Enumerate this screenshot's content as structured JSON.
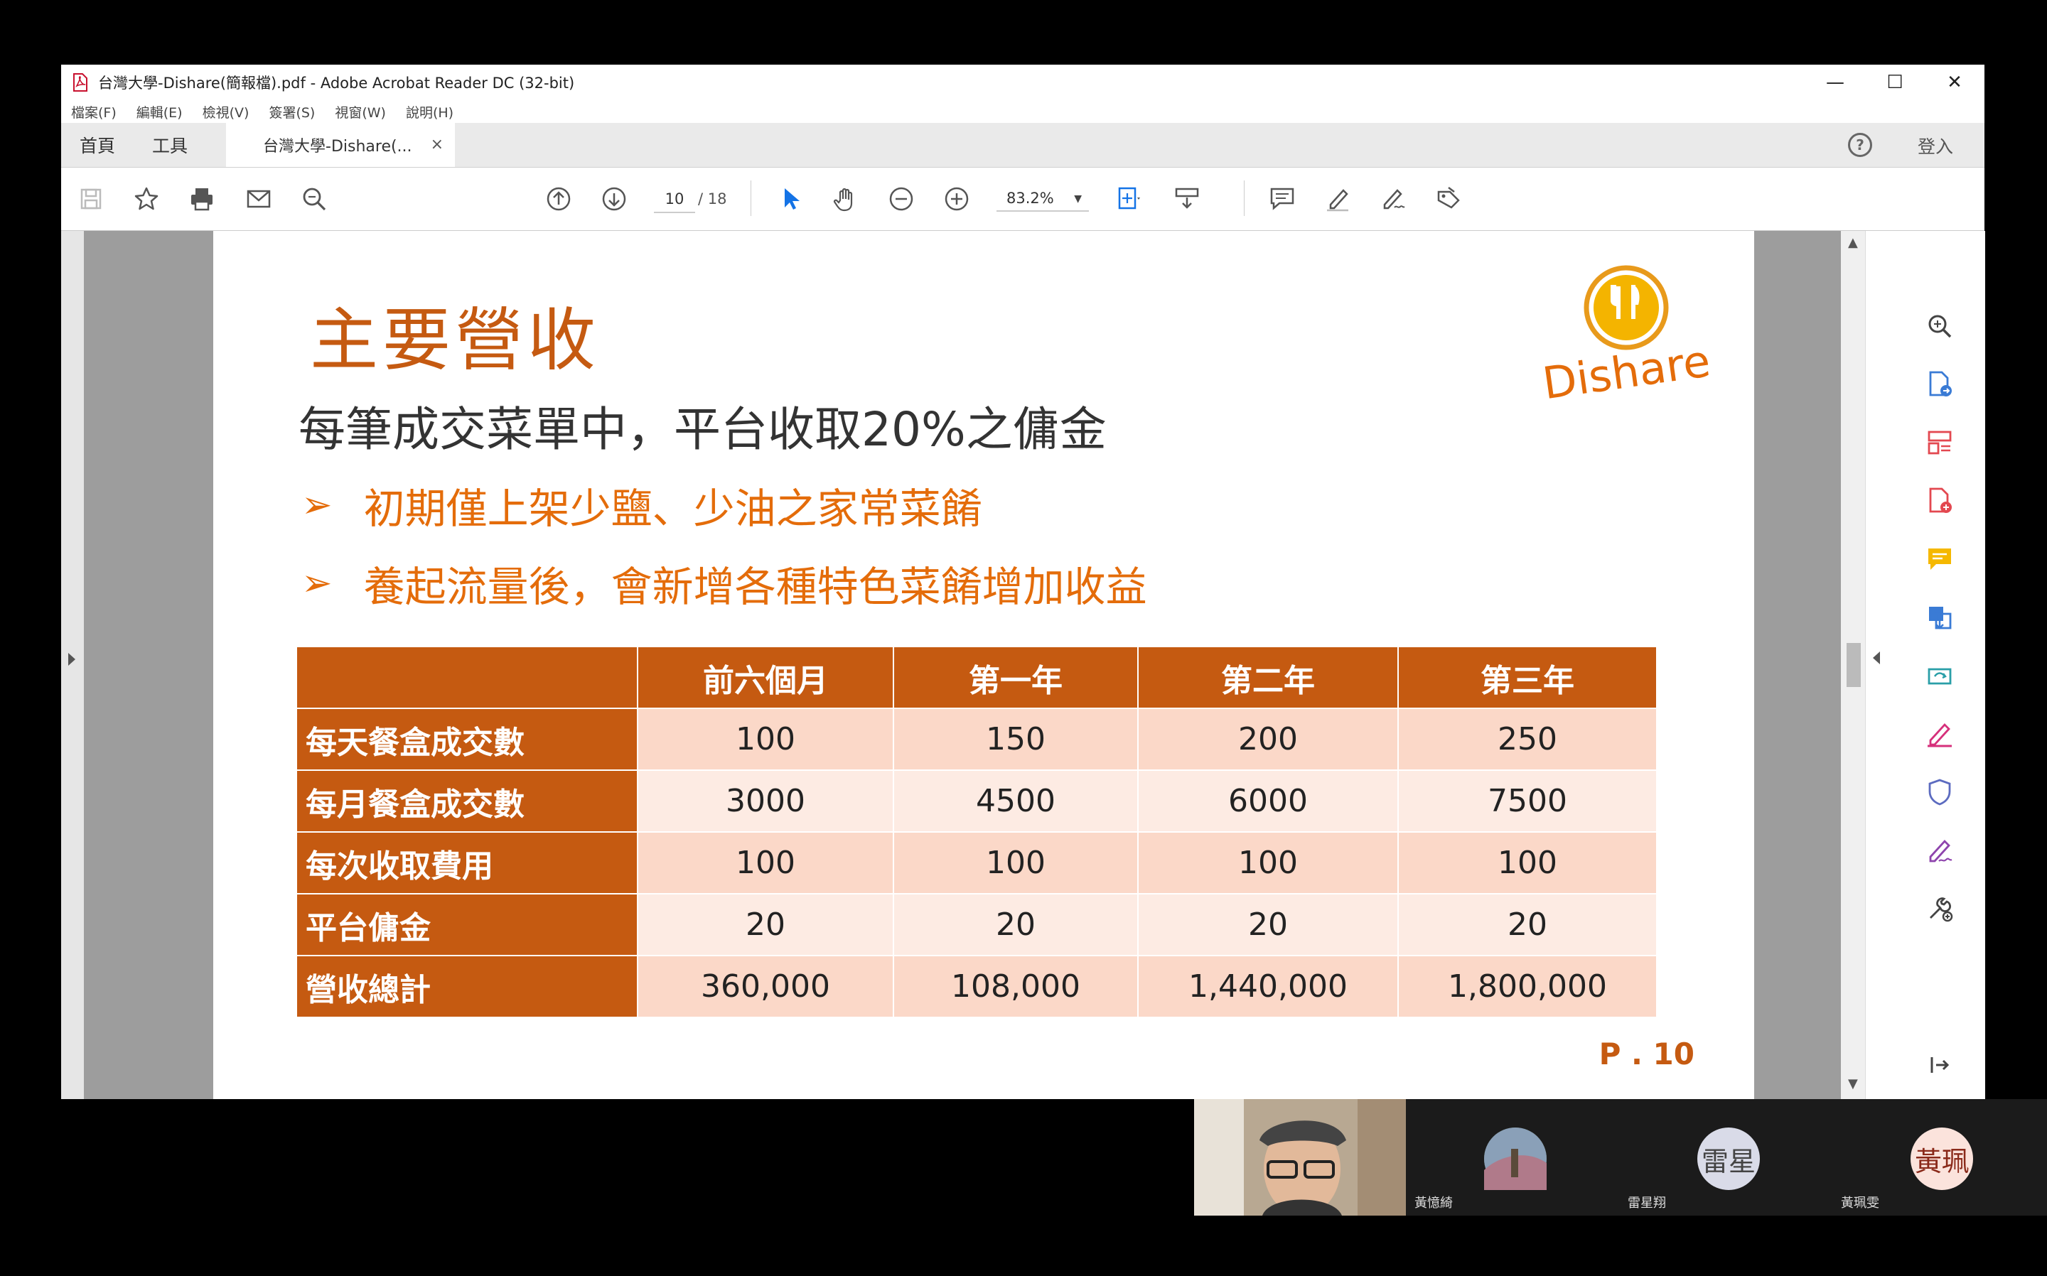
{
  "window": {
    "title": "台灣大學-Dishare(簡報檔).pdf - Adobe Acrobat Reader DC (32-bit)",
    "minimize": "—",
    "maximize": "☐",
    "close": "✕"
  },
  "menu": [
    "檔案(F)",
    "編輯(E)",
    "檢視(V)",
    "簽署(S)",
    "視窗(W)",
    "說明(H)"
  ],
  "tabs": {
    "home": "首頁",
    "tools": "工具",
    "document": "台灣大學-Dishare(...",
    "document_close": "×",
    "help": "?",
    "login": "登入"
  },
  "toolbar": {
    "page_current": "10",
    "page_total": "/ 18",
    "zoom": "83.2%"
  },
  "slide": {
    "title": "主要營收",
    "subtitle": "每筆成交菜單中，平台收取20%之傭金",
    "bullets": [
      "初期僅上架少鹽、少油之家常菜餚",
      "養起流量後，會新增各種特色菜餚增加收益"
    ],
    "bullet_marker": "➢",
    "logo_text": "Dishare",
    "page_number": "P . 10",
    "table": {
      "headers": [
        "",
        "前六個月",
        "第一年",
        "第二年",
        "第三年"
      ],
      "rows": [
        {
          "label": "每天餐盒成交數",
          "values": [
            "100",
            "150",
            "200",
            "250"
          ]
        },
        {
          "label": "每月餐盒成交數",
          "values": [
            "3000",
            "4500",
            "6000",
            "7500"
          ]
        },
        {
          "label": "每次收取費用",
          "values": [
            "100",
            "100",
            "100",
            "100"
          ]
        },
        {
          "label": "平台傭金",
          "values": [
            "20",
            "20",
            "20",
            "20"
          ]
        },
        {
          "label": "營收總計",
          "values": [
            "360,000",
            "108,000",
            "1,440,000",
            "1,800,000"
          ]
        }
      ]
    }
  },
  "participants": [
    {
      "name": "",
      "avatar": "camera"
    },
    {
      "name": "黃憶綺",
      "avatar": "photo"
    },
    {
      "name": "雷星翔",
      "avatar_text": "雷星"
    },
    {
      "name": "黃珮雯",
      "avatar_text": "黃珮"
    }
  ],
  "colors": {
    "brand_orange": "#c55a11",
    "bullet_orange": "#e46c0a",
    "row_odd": "#fbd8c8",
    "row_even": "#fdebe3"
  }
}
